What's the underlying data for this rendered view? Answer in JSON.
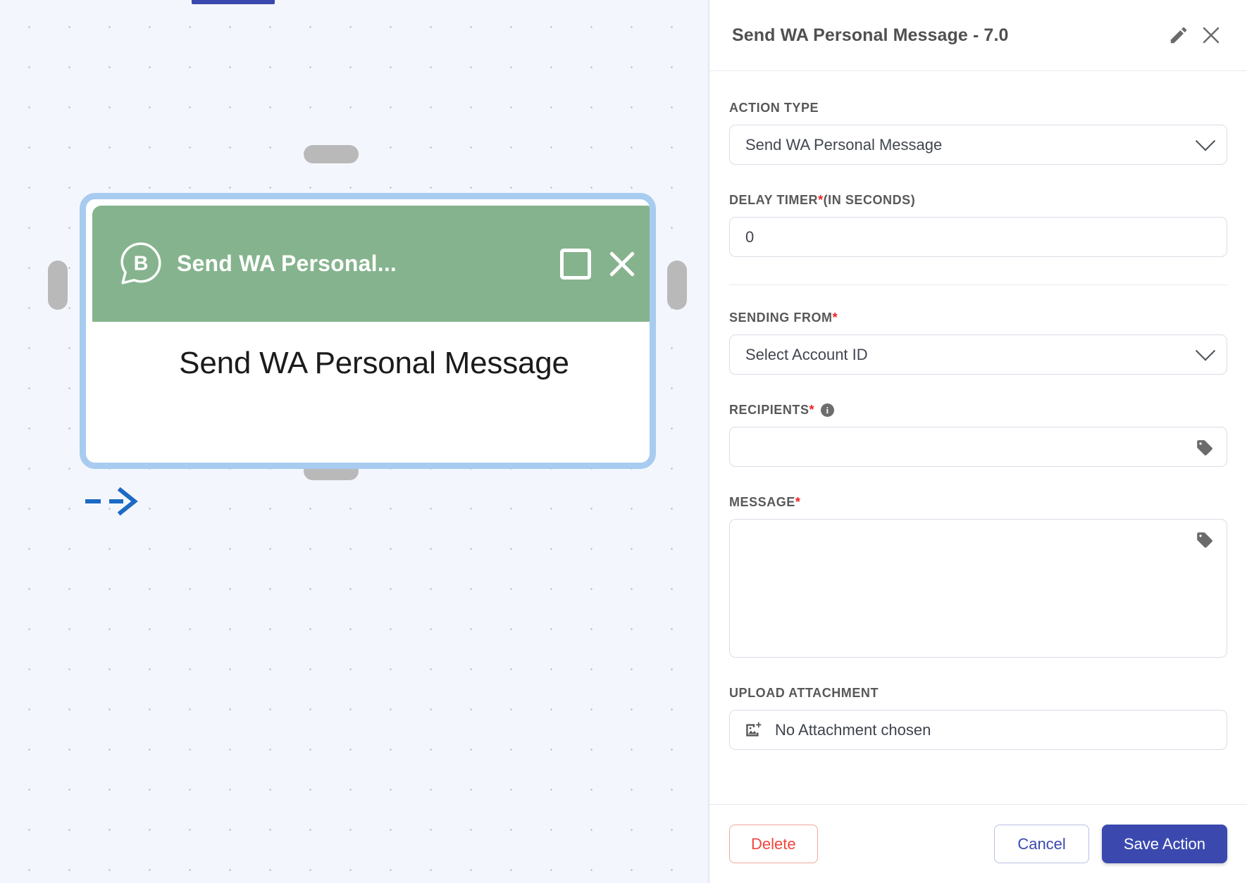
{
  "canvas": {
    "node": {
      "header_title": "Send WA Personal...",
      "body_text": "Send WA Personal Message",
      "logo_icon": "whatsapp-business-b-icon",
      "expand_icon": "square-icon",
      "close_icon": "close-icon",
      "header_color": "#85b38d",
      "selection_color": "#a8cbf0"
    },
    "handles": {
      "top": "node-handle-top",
      "bottom": "node-handle-bottom",
      "left": "node-handle-left",
      "right": "node-handle-right"
    },
    "edge": {
      "style": "dashed-arrow",
      "color": "#1c6ac4"
    },
    "tab_color": "#3b49af",
    "background_color": "#f3f7fd"
  },
  "panel": {
    "title": "Send WA Personal Message - 7.0",
    "edit_icon": "pencil-icon",
    "close_icon": "close-icon",
    "fields": {
      "action_type": {
        "label": "ACTION TYPE",
        "value": "Send WA Personal Message",
        "chevron_icon": "chevron-down-icon"
      },
      "delay_timer": {
        "label": "DELAY TIMER ",
        "required": "*",
        "label_suffix": "(IN SECONDS)",
        "value": "0"
      },
      "sending_from": {
        "label": "SENDING FROM",
        "required": "*",
        "value": "Select Account ID",
        "chevron_icon": "chevron-down-icon"
      },
      "recipients": {
        "label": "RECIPIENTS",
        "required": "*",
        "info_icon": "info-icon",
        "value": "",
        "placeholder": "",
        "tag_icon": "tag-icon"
      },
      "message": {
        "label": "MESSAGE",
        "required": "*",
        "value": "",
        "placeholder": "",
        "tag_icon": "tag-icon"
      },
      "upload_attachment": {
        "label": "UPLOAD ATTACHMENT",
        "value": "No Attachment chosen",
        "icon": "image-add-icon"
      }
    },
    "footer": {
      "delete_label": "Delete",
      "cancel_label": "Cancel",
      "save_label": "Save Action",
      "delete_color": "#f2453d",
      "accent_color": "#3b49af"
    }
  }
}
